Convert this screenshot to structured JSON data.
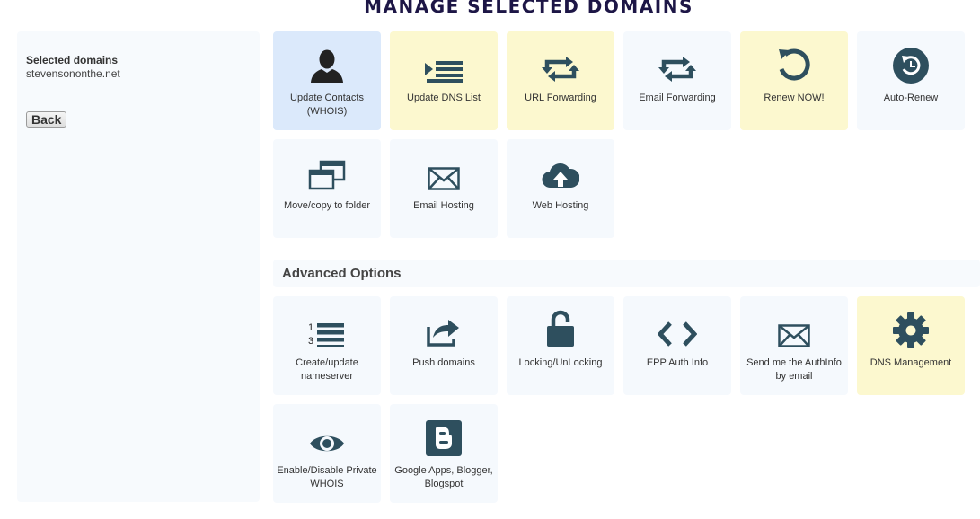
{
  "page": {
    "title": "MANAGE SELECTED DOMAINS"
  },
  "sidebar": {
    "selected_label": "Selected domains",
    "selected_domain": "stevensononthe.net",
    "back_label": "Back"
  },
  "tiles": [
    {
      "label": "Update Contacts (WHOIS)",
      "icon": "user-icon",
      "state": "selected"
    },
    {
      "label": "Update DNS List",
      "icon": "dns-list-icon",
      "state": "highlight"
    },
    {
      "label": "URL Forwarding",
      "icon": "forward-arrows-icon",
      "state": "highlight"
    },
    {
      "label": "Email Forwarding",
      "icon": "forward-arrows-icon",
      "state": "normal"
    },
    {
      "label": "Renew NOW!",
      "icon": "renew-icon",
      "state": "highlight"
    },
    {
      "label": "Auto-Renew",
      "icon": "auto-renew-icon",
      "state": "normal"
    },
    {
      "label": "Move/copy to folder",
      "icon": "windows-icon",
      "state": "normal"
    },
    {
      "label": "Email Hosting",
      "icon": "envelope-icon",
      "state": "normal"
    },
    {
      "label": "Web Hosting",
      "icon": "cloud-upload-icon",
      "state": "normal"
    }
  ],
  "advanced": {
    "title": "Advanced Options",
    "tiles": [
      {
        "label": "Create/update nameserver",
        "icon": "numbered-list-icon",
        "state": "normal"
      },
      {
        "label": "Push domains",
        "icon": "share-icon",
        "state": "normal"
      },
      {
        "label": "Locking/UnLocking",
        "icon": "unlock-icon",
        "state": "normal"
      },
      {
        "label": "EPP Auth Info",
        "icon": "code-icon",
        "state": "normal"
      },
      {
        "label": "Send me the AuthInfo by email",
        "icon": "envelope-icon",
        "state": "normal"
      },
      {
        "label": "DNS Management",
        "icon": "gear-icon",
        "state": "highlight"
      },
      {
        "label": "Enable/Disable Private WHOIS",
        "icon": "eye-icon",
        "state": "normal"
      },
      {
        "label": "Google Apps, Blogger, Blogspot",
        "icon": "blogger-icon",
        "state": "normal"
      }
    ]
  },
  "colors": {
    "icon": "#2e4f5e",
    "title": "#1d1646",
    "tile_bg": "#f5f9fd",
    "tile_selected": "#dbe9fb",
    "tile_highlight": "#fcf8cf"
  }
}
